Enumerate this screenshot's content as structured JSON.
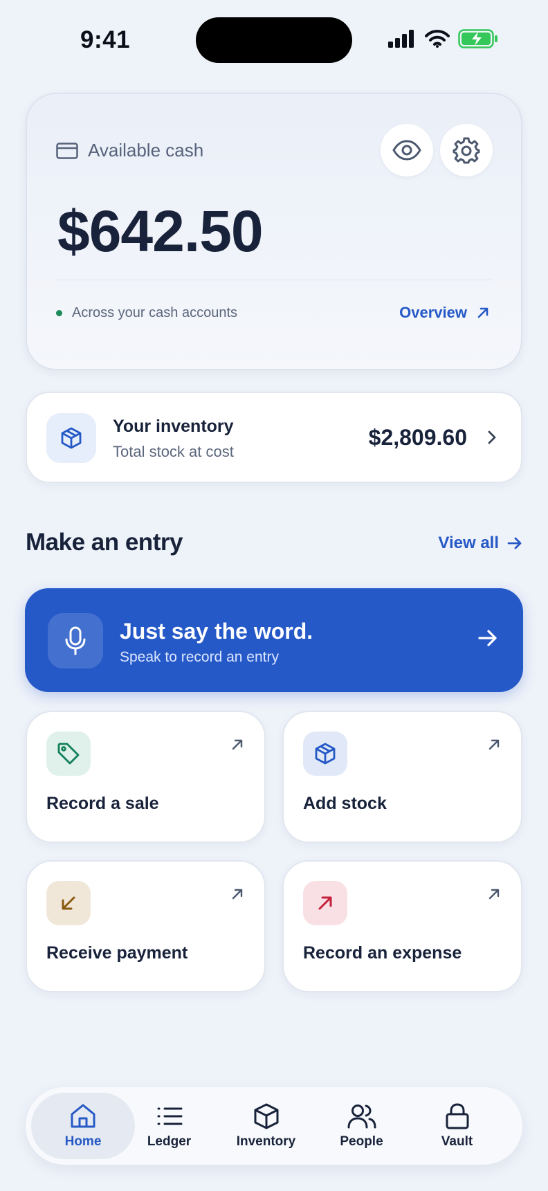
{
  "status_bar": {
    "time": "9:41"
  },
  "cash_card": {
    "label": "Available cash",
    "amount": "$642.50",
    "subtitle": "Across your cash accounts",
    "link": "Overview"
  },
  "inventory_card": {
    "title": "Your inventory",
    "subtitle": "Total stock at cost",
    "amount": "$2,809.60"
  },
  "entry_section": {
    "title": "Make an entry",
    "view_all": "View all"
  },
  "voice_banner": {
    "title": "Just say the word.",
    "subtitle": "Speak to record an entry"
  },
  "actions": [
    {
      "label": "Record a sale",
      "icon": "tag-icon",
      "icon_bg": "#dff1ea",
      "icon_color": "#13805a"
    },
    {
      "label": "Add stock",
      "icon": "box-icon",
      "icon_bg": "#e1e9f8",
      "icon_color": "#2559c6"
    },
    {
      "label": "Receive payment",
      "icon": "arrow-down-left-icon",
      "icon_bg": "#f1e7d9",
      "icon_color": "#8a5a12"
    },
    {
      "label": "Record an expense",
      "icon": "arrow-up-right-icon",
      "icon_bg": "#f8e0e4",
      "icon_color": "#c4213d"
    }
  ],
  "nav": {
    "items": [
      {
        "label": "Home",
        "icon": "home-icon",
        "active": true
      },
      {
        "label": "Ledger",
        "icon": "list-icon"
      },
      {
        "label": "Inventory",
        "icon": "box-icon"
      },
      {
        "label": "People",
        "icon": "people-icon"
      },
      {
        "label": "Vault",
        "icon": "lock-icon"
      }
    ]
  },
  "colors": {
    "accent": "#2559c6",
    "battery": "#34c759"
  }
}
